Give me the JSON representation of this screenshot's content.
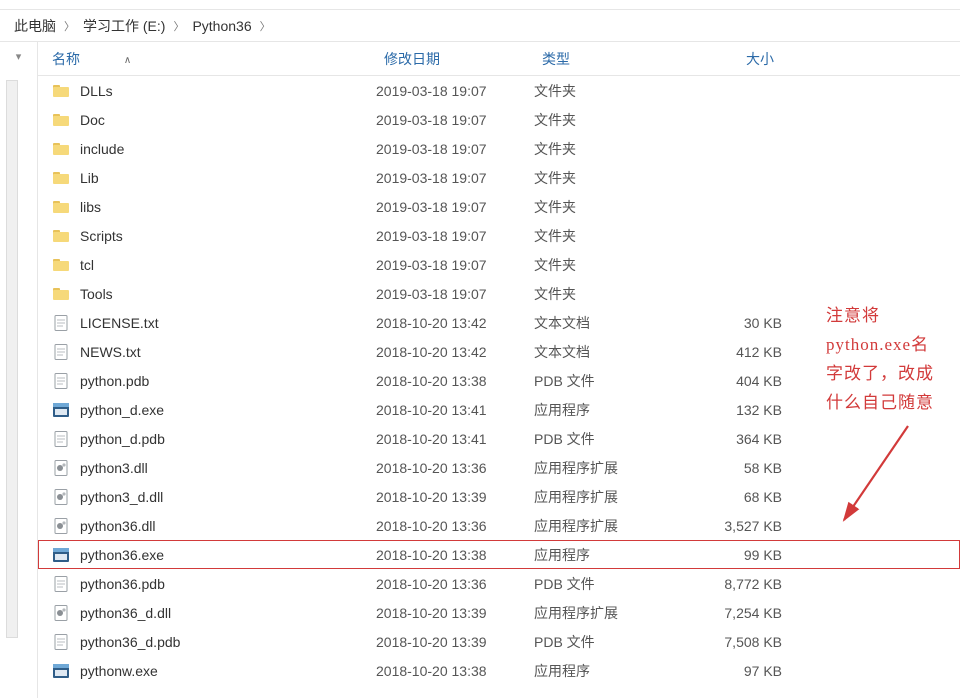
{
  "breadcrumb": {
    "items": [
      "此电脑",
      "学习工作 (E:)",
      "Python36"
    ]
  },
  "columns": {
    "name": "名称",
    "date": "修改日期",
    "type": "类型",
    "size": "大小",
    "sort_indicator": "∧"
  },
  "rows": [
    {
      "icon": "folder",
      "name": "DLLs",
      "date": "2019-03-18 19:07",
      "type": "文件夹",
      "size": ""
    },
    {
      "icon": "folder",
      "name": "Doc",
      "date": "2019-03-18 19:07",
      "type": "文件夹",
      "size": ""
    },
    {
      "icon": "folder",
      "name": "include",
      "date": "2019-03-18 19:07",
      "type": "文件夹",
      "size": ""
    },
    {
      "icon": "folder",
      "name": "Lib",
      "date": "2019-03-18 19:07",
      "type": "文件夹",
      "size": ""
    },
    {
      "icon": "folder",
      "name": "libs",
      "date": "2019-03-18 19:07",
      "type": "文件夹",
      "size": ""
    },
    {
      "icon": "folder",
      "name": "Scripts",
      "date": "2019-03-18 19:07",
      "type": "文件夹",
      "size": ""
    },
    {
      "icon": "folder",
      "name": "tcl",
      "date": "2019-03-18 19:07",
      "type": "文件夹",
      "size": ""
    },
    {
      "icon": "folder",
      "name": "Tools",
      "date": "2019-03-18 19:07",
      "type": "文件夹",
      "size": ""
    },
    {
      "icon": "file",
      "name": "LICENSE.txt",
      "date": "2018-10-20 13:42",
      "type": "文本文档",
      "size": "30 KB"
    },
    {
      "icon": "file",
      "name": "NEWS.txt",
      "date": "2018-10-20 13:42",
      "type": "文本文档",
      "size": "412 KB"
    },
    {
      "icon": "file",
      "name": "python.pdb",
      "date": "2018-10-20 13:38",
      "type": "PDB 文件",
      "size": "404 KB"
    },
    {
      "icon": "exe",
      "name": "python_d.exe",
      "date": "2018-10-20 13:41",
      "type": "应用程序",
      "size": "132 KB"
    },
    {
      "icon": "file",
      "name": "python_d.pdb",
      "date": "2018-10-20 13:41",
      "type": "PDB 文件",
      "size": "364 KB"
    },
    {
      "icon": "dll",
      "name": "python3.dll",
      "date": "2018-10-20 13:36",
      "type": "应用程序扩展",
      "size": "58 KB"
    },
    {
      "icon": "dll",
      "name": "python3_d.dll",
      "date": "2018-10-20 13:39",
      "type": "应用程序扩展",
      "size": "68 KB"
    },
    {
      "icon": "dll",
      "name": "python36.dll",
      "date": "2018-10-20 13:36",
      "type": "应用程序扩展",
      "size": "3,527 KB"
    },
    {
      "icon": "exe",
      "name": "python36.exe",
      "date": "2018-10-20 13:38",
      "type": "应用程序",
      "size": "99 KB",
      "highlight": true
    },
    {
      "icon": "file",
      "name": "python36.pdb",
      "date": "2018-10-20 13:36",
      "type": "PDB 文件",
      "size": "8,772 KB"
    },
    {
      "icon": "dll",
      "name": "python36_d.dll",
      "date": "2018-10-20 13:39",
      "type": "应用程序扩展",
      "size": "7,254 KB"
    },
    {
      "icon": "file",
      "name": "python36_d.pdb",
      "date": "2018-10-20 13:39",
      "type": "PDB 文件",
      "size": "7,508 KB"
    },
    {
      "icon": "exe",
      "name": "pythonw.exe",
      "date": "2018-10-20 13:38",
      "type": "应用程序",
      "size": "97 KB"
    }
  ],
  "annotation": {
    "line1": "注意将",
    "line2": "python.exe名",
    "line3": "字改了，改成",
    "line4": "什么自己随意"
  }
}
